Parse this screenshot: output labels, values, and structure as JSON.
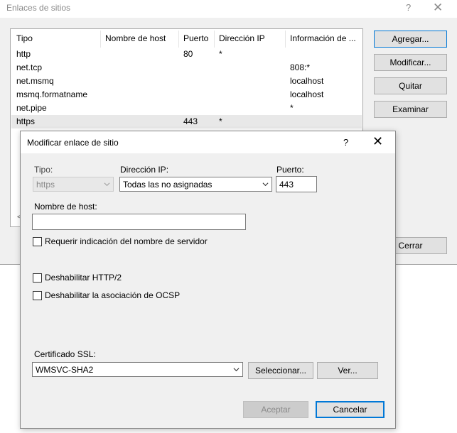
{
  "sites_dialog": {
    "title": "Enlaces de sitios",
    "help_glyph": "?",
    "close_glyph": "✕",
    "columns": [
      "Tipo",
      "Nombre de host",
      "Puerto",
      "Dirección IP",
      "Información de ..."
    ],
    "rows": [
      {
        "type": "http",
        "host": "",
        "port": "80",
        "ip": "*",
        "info": ""
      },
      {
        "type": "net.tcp",
        "host": "",
        "port": "",
        "ip": "",
        "info": "808:*"
      },
      {
        "type": "net.msmq",
        "host": "",
        "port": "",
        "ip": "",
        "info": "localhost"
      },
      {
        "type": "msmq.formatname",
        "host": "",
        "port": "",
        "ip": "",
        "info": "localhost"
      },
      {
        "type": "net.pipe",
        "host": "",
        "port": "",
        "ip": "",
        "info": "*"
      },
      {
        "type": "https",
        "host": "",
        "port": "443",
        "ip": "*",
        "info": ""
      }
    ],
    "scroll_left_glyph": "<",
    "buttons": {
      "add": "Agregar...",
      "edit": "Modificar...",
      "remove": "Quitar",
      "browse": "Examinar",
      "close": "Cerrar"
    }
  },
  "edit_dialog": {
    "title": "Modificar enlace de sitio",
    "help_glyph": "?",
    "close_glyph": "✕",
    "type_label": "Tipo:",
    "type_value": "https",
    "ip_label": "Dirección IP:",
    "ip_value": "Todas las no asignadas",
    "port_label": "Puerto:",
    "port_value": "443",
    "host_label": "Nombre de host:",
    "host_value": "",
    "checkboxes": {
      "sni": {
        "label": "Requerir indicación del nombre de servidor",
        "checked": false
      },
      "http2": {
        "label": "Deshabilitar HTTP/2",
        "checked": false
      },
      "ocsp": {
        "label": "Deshabilitar la asociación de OCSP",
        "checked": false
      }
    },
    "ssl_label": "Certificado SSL:",
    "ssl_value": "WMSVC-SHA2",
    "select_button": "Seleccionar...",
    "view_button": "Ver...",
    "ok_button": "Aceptar",
    "cancel_button": "Cancelar"
  }
}
